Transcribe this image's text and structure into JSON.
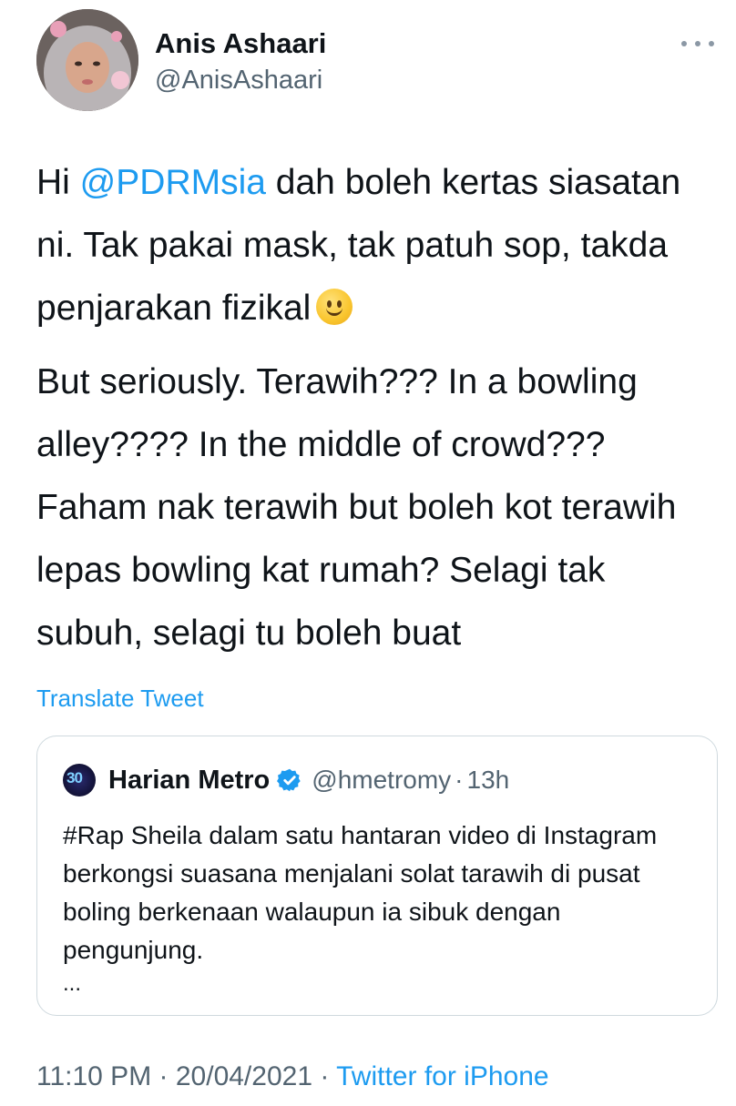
{
  "user": {
    "name": "Anis Ashaari",
    "handle": "@AnisAshaari"
  },
  "tweet": {
    "p1_start": "Hi ",
    "p1_mention": "@PDRMsia",
    "p1_rest": " dah boleh kertas siasatan ni. Tak pakai mask, tak patuh sop, takda penjarakan fizikal",
    "p1_emoji": "slightly-smiling-face",
    "p2": "But seriously. Terawih??? In a bowling alley???? In the middle of crowd??? Faham nak terawih but boleh kot terawih lepas bowling kat rumah? Selagi tak subuh, selagi tu boleh buat"
  },
  "translate_label": "Translate Tweet",
  "quote": {
    "name": "Harian Metro",
    "handle": "@hmetromy",
    "separator": "·",
    "time": "13h",
    "text": "#Rap Sheila dalam satu hantaran video di Instagram berkongsi suasana menjalani solat tarawih di pusat boling berkenaan walaupun ia sibuk dengan pengunjung.",
    "ellipsis": "...",
    "avatar_logo_text": "30"
  },
  "meta": {
    "time": "11:10 PM",
    "separator": " · ",
    "date": "20/04/2021",
    "separator2": " · ",
    "source": "Twitter for iPhone"
  },
  "colors": {
    "accent": "#1d9bf0",
    "text": "#0f1419",
    "secondary": "#536471",
    "border": "#cfd9de"
  }
}
